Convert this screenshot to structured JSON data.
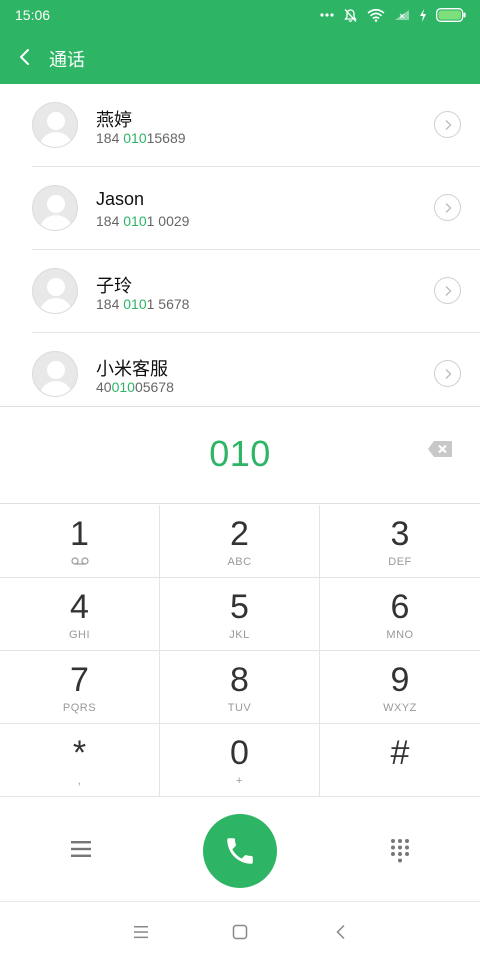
{
  "status_bar": {
    "time": "15:06",
    "icons": [
      "more-dots-icon",
      "mute-bell-icon",
      "wifi-icon",
      "signal-icon",
      "charging-icon",
      "battery-icon"
    ]
  },
  "header": {
    "title": "通话",
    "back_icon": "back-arrow-icon"
  },
  "contacts": [
    {
      "name": "燕婷",
      "number_prefix": "184 ",
      "number_match": "010",
      "number_suffix": "15689"
    },
    {
      "name": "Jason",
      "number_prefix": "184 ",
      "number_match": "010",
      "number_suffix": "1 0029"
    },
    {
      "name": "子玲",
      "number_prefix": "184 ",
      "number_match": "010",
      "number_suffix": "1 5678"
    },
    {
      "name": "小米客服",
      "number_prefix": "40",
      "number_match": "010",
      "number_suffix": "05678"
    }
  ],
  "dial_input": {
    "value": "010",
    "backspace_icon": "backspace-icon"
  },
  "keypad": [
    {
      "digit": "1",
      "letters": "",
      "sub_icon": "voicemail-icon"
    },
    {
      "digit": "2",
      "letters": "ABC"
    },
    {
      "digit": "3",
      "letters": "DEF"
    },
    {
      "digit": "4",
      "letters": "GHI"
    },
    {
      "digit": "5",
      "letters": "JKL"
    },
    {
      "digit": "6",
      "letters": "MNO"
    },
    {
      "digit": "7",
      "letters": "PQRS"
    },
    {
      "digit": "8",
      "letters": "TUV"
    },
    {
      "digit": "9",
      "letters": "WXYZ"
    },
    {
      "digit": "*",
      "letters": ","
    },
    {
      "digit": "0",
      "letters": "+"
    },
    {
      "digit": "#",
      "letters": ""
    }
  ],
  "actions": {
    "menu_icon": "menu-icon",
    "call_icon": "phone-icon",
    "dialpad_icon": "dialpad-icon"
  },
  "system_nav": [
    "menu-icon",
    "home-icon",
    "back-icon"
  ],
  "colors": {
    "accent": "#2db565",
    "divider": "#e4e4e4",
    "text_secondary": "#666666",
    "letters": "#999999"
  }
}
